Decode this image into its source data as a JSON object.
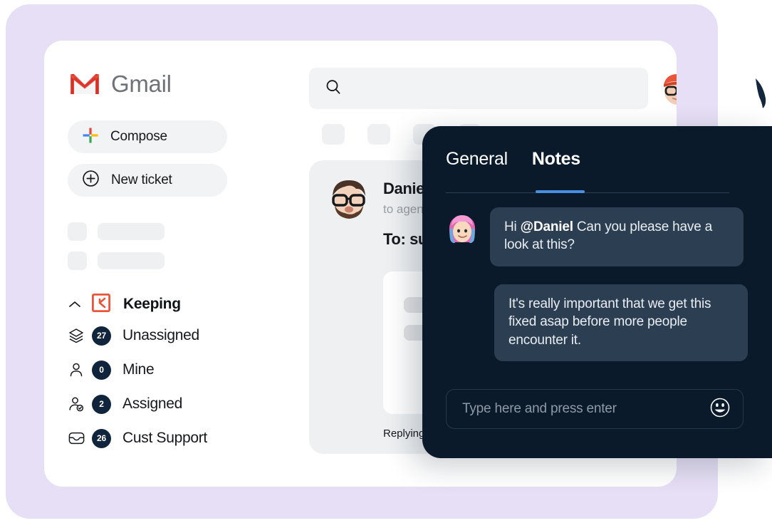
{
  "theme": {
    "backdrop_color": "#e6dff5",
    "window_color": "#ffffff",
    "panel_color": "#0a1a2b",
    "bubble_color": "#2c3f52",
    "badge_color": "#10243c",
    "accent_blue": "#4a90e2",
    "keeping_orange": "#e8553a",
    "gmail_red": "#d93025"
  },
  "sidebar": {
    "brand": {
      "name": "Gmail",
      "icon": "gmail-logo-icon"
    },
    "compose": {
      "label": "Compose",
      "icon": "google-plus-icon"
    },
    "new_ticket": {
      "label": "New ticket",
      "icon": "circle-plus-icon"
    },
    "nav_header": {
      "label": "Keeping",
      "icon": "keeping-logo-icon",
      "chevron": "chevron-up-icon"
    },
    "items": [
      {
        "label": "Unassigned",
        "count": "27",
        "icon": "layers-icon"
      },
      {
        "label": "Mine",
        "count": "0",
        "icon": "person-icon"
      },
      {
        "label": "Assigned",
        "count": "2",
        "icon": "person-check-icon"
      },
      {
        "label": "Cust Support",
        "count": "26",
        "icon": "inbox-icon"
      }
    ]
  },
  "main": {
    "search": {
      "value": "",
      "placeholder": "",
      "icon": "search-icon"
    },
    "account_avatar": "user-avatar-beanie-glasses",
    "email": {
      "avatar": "sender-avatar-bearded-glasses",
      "from": "Daniel LaRu",
      "to_agents": "to agents",
      "to_line": "To: support@",
      "replying_note": "Replying to this no"
    }
  },
  "notes_panel": {
    "tabs": [
      {
        "label": "General",
        "active": false
      },
      {
        "label": "Notes",
        "active": true
      }
    ],
    "messages": [
      {
        "avatar": "note-author-avatar-pink-hair",
        "text_prefix": "Hi ",
        "mention": "@Daniel",
        "text_suffix": " Can you please have a look at this?"
      },
      {
        "avatar": "",
        "text": "It's really important that we get this fixed asap before more people encounter it."
      }
    ],
    "composer": {
      "value": "",
      "placeholder": "Type here and press enter",
      "emoji_icon": "smiley-face-icon"
    }
  }
}
